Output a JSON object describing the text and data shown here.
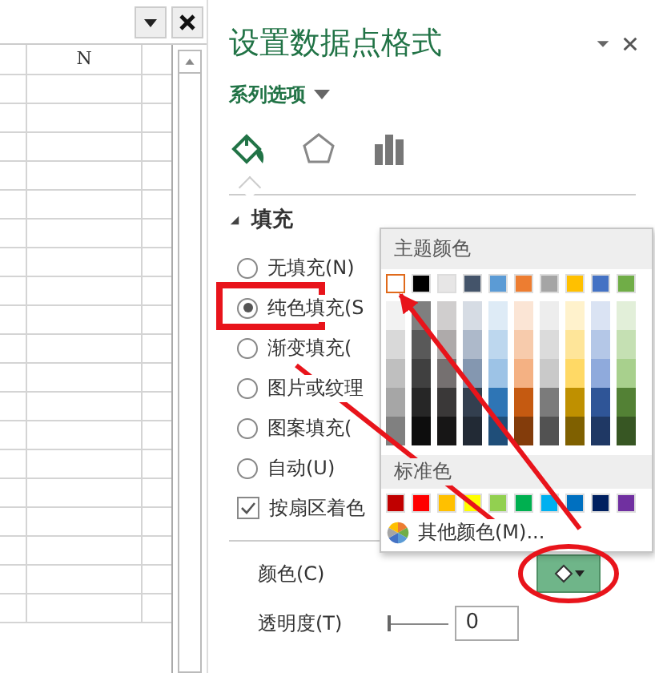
{
  "sheet": {
    "column_header": "N"
  },
  "pane": {
    "title": "设置数据点格式",
    "series_menu": "系列选项",
    "tabs": [
      {
        "kind": "fill",
        "selected": true
      },
      {
        "kind": "effects",
        "selected": false
      },
      {
        "kind": "series",
        "selected": false
      }
    ],
    "section": {
      "title": "填充",
      "expanded": true
    },
    "fill_options": [
      {
        "label": "无填充(N)",
        "selected": false
      },
      {
        "label": "纯色填充(S",
        "selected": true
      },
      {
        "label": "渐变填充(",
        "selected": false
      },
      {
        "label": "图片或纹理",
        "selected": false
      },
      {
        "label": "图案填充(",
        "selected": false
      },
      {
        "label": "自动(U)",
        "selected": false
      }
    ],
    "vary_colors": {
      "label": "按扇区着色",
      "checked": true
    },
    "color_label": "颜色(C)",
    "transparency": {
      "label": "透明度(T)",
      "level": 0,
      "value": "0"
    }
  },
  "color_picker": {
    "theme_title": "主题颜色",
    "theme": [
      {
        "color": "#ffffff",
        "selected": true,
        "shades": [
          {
            "color": "#f2f2f2"
          },
          {
            "color": "#d9d9d9"
          },
          {
            "color": "#bfbfbf"
          },
          {
            "color": "#a6a6a6"
          },
          {
            "color": "#808080"
          }
        ]
      },
      {
        "color": "#000000",
        "selected": false,
        "shades": [
          {
            "color": "#7f7f7f"
          },
          {
            "color": "#595959"
          },
          {
            "color": "#404040"
          },
          {
            "color": "#262626"
          },
          {
            "color": "#0d0d0d"
          }
        ]
      },
      {
        "color": "#e7e6e6",
        "selected": false,
        "shades": [
          {
            "color": "#d0cece"
          },
          {
            "color": "#aeaaaa"
          },
          {
            "color": "#757070"
          },
          {
            "color": "#3a3838"
          },
          {
            "color": "#171616"
          }
        ]
      },
      {
        "color": "#44546a",
        "selected": false,
        "shades": [
          {
            "color": "#d6dce4"
          },
          {
            "color": "#adb9ca"
          },
          {
            "color": "#8497b0"
          },
          {
            "color": "#333f4f"
          },
          {
            "color": "#222a35"
          }
        ]
      },
      {
        "color": "#5b9bd5",
        "selected": false,
        "shades": [
          {
            "color": "#deebf6"
          },
          {
            "color": "#bdd7ee"
          },
          {
            "color": "#9dc3e6"
          },
          {
            "color": "#2e75b5"
          },
          {
            "color": "#1f4e79"
          }
        ]
      },
      {
        "color": "#ed7d31",
        "selected": false,
        "shades": [
          {
            "color": "#fbe5d5"
          },
          {
            "color": "#f7cbac"
          },
          {
            "color": "#f4b183"
          },
          {
            "color": "#c55a11"
          },
          {
            "color": "#833c0b"
          }
        ]
      },
      {
        "color": "#a5a5a5",
        "selected": false,
        "shades": [
          {
            "color": "#ededed"
          },
          {
            "color": "#dbdbdb"
          },
          {
            "color": "#c9c9c9"
          },
          {
            "color": "#7b7b7b"
          },
          {
            "color": "#525252"
          }
        ]
      },
      {
        "color": "#ffc000",
        "selected": false,
        "shades": [
          {
            "color": "#fff2cc"
          },
          {
            "color": "#fee599"
          },
          {
            "color": "#ffd965"
          },
          {
            "color": "#bf9000"
          },
          {
            "color": "#7f6000"
          }
        ]
      },
      {
        "color": "#4472c4",
        "selected": false,
        "shades": [
          {
            "color": "#dae3f3"
          },
          {
            "color": "#b4c7e7"
          },
          {
            "color": "#8faadc"
          },
          {
            "color": "#2f5597"
          },
          {
            "color": "#1f3864"
          }
        ]
      },
      {
        "color": "#70ad47",
        "selected": false,
        "shades": [
          {
            "color": "#e2efd9"
          },
          {
            "color": "#c5e0b3"
          },
          {
            "color": "#a8d08d"
          },
          {
            "color": "#538135"
          },
          {
            "color": "#375623"
          }
        ]
      }
    ],
    "standard_title": "标准色",
    "standard": [
      {
        "color": "#c00000"
      },
      {
        "color": "#ff0000"
      },
      {
        "color": "#ffc000"
      },
      {
        "color": "#ffff00"
      },
      {
        "color": "#92d050"
      },
      {
        "color": "#00b050"
      },
      {
        "color": "#00b0f0"
      },
      {
        "color": "#0070c0"
      },
      {
        "color": "#002060"
      },
      {
        "color": "#7030a0"
      }
    ],
    "more": "其他颜色(M)..."
  }
}
